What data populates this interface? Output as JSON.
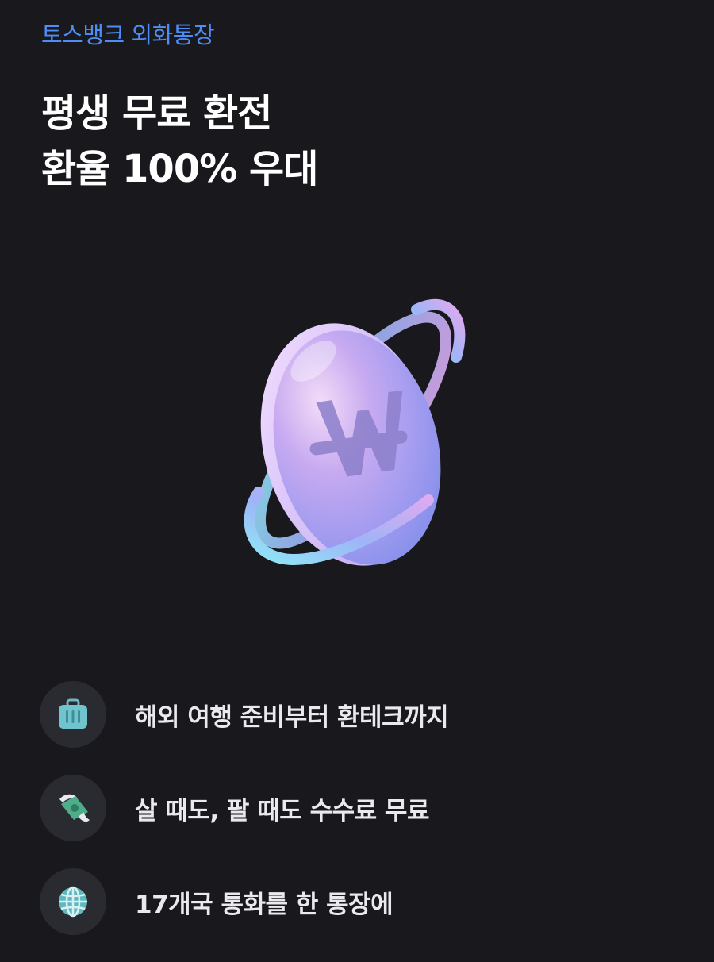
{
  "header": {
    "eyebrow": "토스뱅크 외화통장",
    "headline_line1": "평생 무료 환전",
    "headline_line2": "환율 100% 우대"
  },
  "hero": {
    "icon": "won-coin-with-ring-icon"
  },
  "features": [
    {
      "icon": "suitcase-icon",
      "text": "해외 여행 준비부터 환테크까지"
    },
    {
      "icon": "winged-money-icon",
      "text": "살 때도, 팔 때도 수수료 무료"
    },
    {
      "icon": "globe-icon",
      "text": "17개국 통화를 한 통장에"
    }
  ],
  "colors": {
    "background": "#18181d",
    "accent": "#4e8df5",
    "icon_circle": "#2a2b31"
  }
}
